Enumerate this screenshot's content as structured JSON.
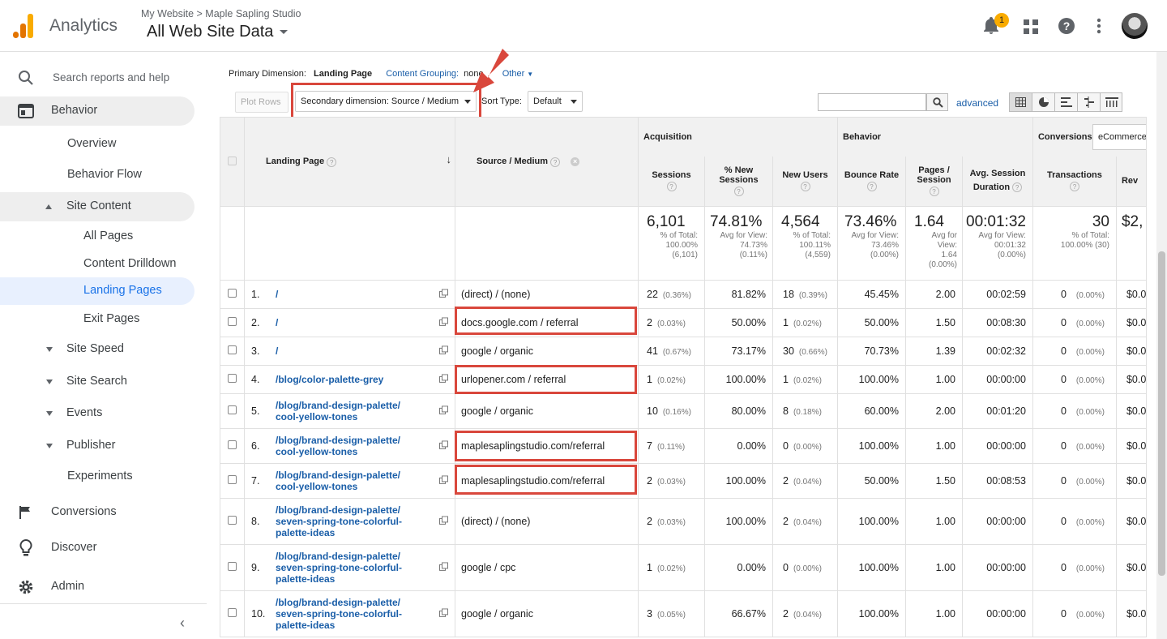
{
  "header": {
    "app_name": "Analytics",
    "breadcrumb": "My Website > Maple Sapling Studio",
    "property": "All Web Site Data",
    "notification_count": "1"
  },
  "sidebar": {
    "search_placeholder": "Search reports and help",
    "behavior": "Behavior",
    "overview": "Overview",
    "behavior_flow": "Behavior Flow",
    "site_content": "Site Content",
    "all_pages": "All Pages",
    "content_drilldown": "Content Drilldown",
    "landing_pages": "Landing Pages",
    "exit_pages": "Exit Pages",
    "site_speed": "Site Speed",
    "site_search": "Site Search",
    "events": "Events",
    "publisher": "Publisher",
    "experiments": "Experiments",
    "conversions": "Conversions",
    "discover": "Discover",
    "admin": "Admin"
  },
  "controls": {
    "primary_dimension_label": "Primary Dimension:",
    "primary_dimension_value": "Landing Page",
    "content_grouping_label": "Content Grouping:",
    "content_grouping_value": "none",
    "other": "Other",
    "plot_rows": "Plot Rows",
    "secondary_dimension": "Secondary dimension: Source / Medium",
    "sort_type_label": "Sort Type:",
    "sort_type_value": "Default",
    "advanced": "advanced"
  },
  "table": {
    "group_acquisition": "Acquisition",
    "group_behavior": "Behavior",
    "group_conversions": "Conversions",
    "conversions_select": "eCommerce",
    "col_landing_page": "Landing Page",
    "col_source_medium": "Source / Medium",
    "col_sessions": "Sessions",
    "col_new_sessions": "% New Sessions",
    "col_new_users": "New Users",
    "col_bounce_rate": "Bounce Rate",
    "col_pages_session": "Pages / Session",
    "col_avg_duration": "Avg. Session Duration",
    "col_transactions": "Transactions",
    "col_revenue": "Rev",
    "totals": {
      "sessions": "6,101",
      "sessions_sub1": "% of Total:",
      "sessions_sub2": "100.00%",
      "sessions_sub3": "(6,101)",
      "new_sessions": "74.81%",
      "new_sessions_sub1": "Avg for View:",
      "new_sessions_sub2": "74.73%",
      "new_sessions_sub3": "(0.11%)",
      "new_users": "4,564",
      "new_users_sub1": "% of Total:",
      "new_users_sub2": "100.11%",
      "new_users_sub3": "(4,559)",
      "bounce": "73.46%",
      "bounce_sub1": "Avg for View:",
      "bounce_sub2": "73.46%",
      "bounce_sub3": "(0.00%)",
      "pages": "1.64",
      "pages_sub1": "Avg for",
      "pages_sub2": "View:",
      "pages_sub3": "1.64",
      "pages_sub4": "(0.00%)",
      "duration": "00:01:32",
      "duration_sub1": "Avg for View:",
      "duration_sub2": "00:01:32",
      "duration_sub3": "(0.00%)",
      "transactions": "30",
      "transactions_sub1": "% of Total:",
      "transactions_sub2": "100.00% (30)",
      "revenue": "$2,"
    },
    "rows": [
      {
        "idx": "1.",
        "page1": "/",
        "page2": "",
        "page3": "",
        "source": "(direct) / (none)",
        "sessions": "22",
        "sessions_pct": "(0.36%)",
        "new_sessions": "81.82%",
        "new_users": "18",
        "new_users_pct": "(0.39%)",
        "bounce": "45.45%",
        "pages": "2.00",
        "duration": "00:02:59",
        "trans": "0",
        "trans_pct": "(0.00%)",
        "rev": "$0.0"
      },
      {
        "idx": "2.",
        "page1": "/",
        "page2": "",
        "page3": "",
        "source": "docs.google.com / referral",
        "sessions": "2",
        "sessions_pct": "(0.03%)",
        "new_sessions": "50.00%",
        "new_users": "1",
        "new_users_pct": "(0.02%)",
        "bounce": "50.00%",
        "pages": "1.50",
        "duration": "00:08:30",
        "trans": "0",
        "trans_pct": "(0.00%)",
        "rev": "$0.0"
      },
      {
        "idx": "3.",
        "page1": "/",
        "page2": "",
        "page3": "",
        "source": "google / organic",
        "sessions": "41",
        "sessions_pct": "(0.67%)",
        "new_sessions": "73.17%",
        "new_users": "30",
        "new_users_pct": "(0.66%)",
        "bounce": "70.73%",
        "pages": "1.39",
        "duration": "00:02:32",
        "trans": "0",
        "trans_pct": "(0.00%)",
        "rev": "$0.0"
      },
      {
        "idx": "4.",
        "page1": "/blog/color-palette-grey",
        "page2": "",
        "page3": "",
        "source": "urlopener.com / referral",
        "sessions": "1",
        "sessions_pct": "(0.02%)",
        "new_sessions": "100.00%",
        "new_users": "1",
        "new_users_pct": "(0.02%)",
        "bounce": "100.00%",
        "pages": "1.00",
        "duration": "00:00:00",
        "trans": "0",
        "trans_pct": "(0.00%)",
        "rev": "$0.0"
      },
      {
        "idx": "5.",
        "page1": "/blog/brand-design-palette/",
        "page2": "cool-yellow-tones",
        "page3": "",
        "source": "google / organic",
        "sessions": "10",
        "sessions_pct": "(0.16%)",
        "new_sessions": "80.00%",
        "new_users": "8",
        "new_users_pct": "(0.18%)",
        "bounce": "60.00%",
        "pages": "2.00",
        "duration": "00:01:20",
        "trans": "0",
        "trans_pct": "(0.00%)",
        "rev": "$0.0"
      },
      {
        "idx": "6.",
        "page1": "/blog/brand-design-palette/",
        "page2": "cool-yellow-tones",
        "page3": "",
        "source": "maplesaplingstudio.com/referral",
        "sessions": "7",
        "sessions_pct": "(0.11%)",
        "new_sessions": "0.00%",
        "new_users": "0",
        "new_users_pct": "(0.00%)",
        "bounce": "100.00%",
        "pages": "1.00",
        "duration": "00:00:00",
        "trans": "0",
        "trans_pct": "(0.00%)",
        "rev": "$0.0"
      },
      {
        "idx": "7.",
        "page1": "/blog/brand-design-palette/",
        "page2": "cool-yellow-tones",
        "page3": "",
        "source": "maplesaplingstudio.com/referral",
        "sessions": "2",
        "sessions_pct": "(0.03%)",
        "new_sessions": "100.00%",
        "new_users": "2",
        "new_users_pct": "(0.04%)",
        "bounce": "50.00%",
        "pages": "1.50",
        "duration": "00:08:53",
        "trans": "0",
        "trans_pct": "(0.00%)",
        "rev": "$0.0"
      },
      {
        "idx": "8.",
        "page1": "/blog/brand-design-palette/",
        "page2": "seven-spring-tone-colorful-",
        "page3": "palette-ideas",
        "source": "(direct) / (none)",
        "sessions": "2",
        "sessions_pct": "(0.03%)",
        "new_sessions": "100.00%",
        "new_users": "2",
        "new_users_pct": "(0.04%)",
        "bounce": "100.00%",
        "pages": "1.00",
        "duration": "00:00:00",
        "trans": "0",
        "trans_pct": "(0.00%)",
        "rev": "$0.0"
      },
      {
        "idx": "9.",
        "page1": "/blog/brand-design-palette/",
        "page2": "seven-spring-tone-colorful-",
        "page3": "palette-ideas",
        "source": "google / cpc",
        "sessions": "1",
        "sessions_pct": "(0.02%)",
        "new_sessions": "0.00%",
        "new_users": "0",
        "new_users_pct": "(0.00%)",
        "bounce": "100.00%",
        "pages": "1.00",
        "duration": "00:00:00",
        "trans": "0",
        "trans_pct": "(0.00%)",
        "rev": "$0.0"
      },
      {
        "idx": "10.",
        "page1": "/blog/brand-design-palette/",
        "page2": "seven-spring-tone-colorful-",
        "page3": "palette-ideas",
        "source": "google / organic",
        "sessions": "3",
        "sessions_pct": "(0.05%)",
        "new_sessions": "66.67%",
        "new_users": "2",
        "new_users_pct": "(0.04%)",
        "bounce": "100.00%",
        "pages": "1.00",
        "duration": "00:00:00",
        "trans": "0",
        "trans_pct": "(0.00%)",
        "rev": "$0.0"
      }
    ]
  },
  "colors": {
    "accent": "#1a73e8",
    "highlight_box": "#d9473c",
    "logo_orange": "#f9ab00",
    "logo_dark": "#e37400"
  }
}
